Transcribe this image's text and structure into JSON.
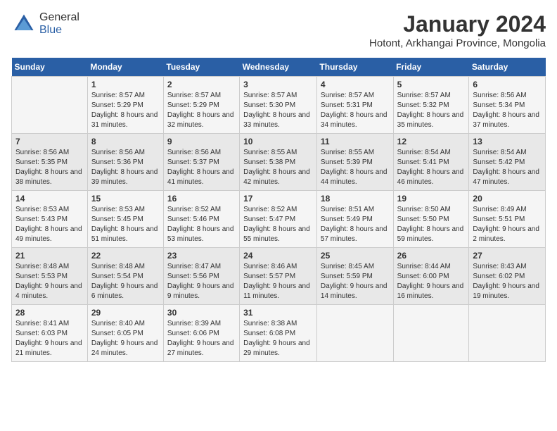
{
  "logo": {
    "general": "General",
    "blue": "Blue"
  },
  "header": {
    "title": "January 2024",
    "subtitle": "Hotont, Arkhangai Province, Mongolia"
  },
  "weekdays": [
    "Sunday",
    "Monday",
    "Tuesday",
    "Wednesday",
    "Thursday",
    "Friday",
    "Saturday"
  ],
  "weeks": [
    [
      {
        "day": "",
        "sunrise": "",
        "sunset": "",
        "daylight": ""
      },
      {
        "day": "1",
        "sunrise": "Sunrise: 8:57 AM",
        "sunset": "Sunset: 5:29 PM",
        "daylight": "Daylight: 8 hours and 31 minutes."
      },
      {
        "day": "2",
        "sunrise": "Sunrise: 8:57 AM",
        "sunset": "Sunset: 5:29 PM",
        "daylight": "Daylight: 8 hours and 32 minutes."
      },
      {
        "day": "3",
        "sunrise": "Sunrise: 8:57 AM",
        "sunset": "Sunset: 5:30 PM",
        "daylight": "Daylight: 8 hours and 33 minutes."
      },
      {
        "day": "4",
        "sunrise": "Sunrise: 8:57 AM",
        "sunset": "Sunset: 5:31 PM",
        "daylight": "Daylight: 8 hours and 34 minutes."
      },
      {
        "day": "5",
        "sunrise": "Sunrise: 8:57 AM",
        "sunset": "Sunset: 5:32 PM",
        "daylight": "Daylight: 8 hours and 35 minutes."
      },
      {
        "day": "6",
        "sunrise": "Sunrise: 8:56 AM",
        "sunset": "Sunset: 5:34 PM",
        "daylight": "Daylight: 8 hours and 37 minutes."
      }
    ],
    [
      {
        "day": "7",
        "sunrise": "Sunrise: 8:56 AM",
        "sunset": "Sunset: 5:35 PM",
        "daylight": "Daylight: 8 hours and 38 minutes."
      },
      {
        "day": "8",
        "sunrise": "Sunrise: 8:56 AM",
        "sunset": "Sunset: 5:36 PM",
        "daylight": "Daylight: 8 hours and 39 minutes."
      },
      {
        "day": "9",
        "sunrise": "Sunrise: 8:56 AM",
        "sunset": "Sunset: 5:37 PM",
        "daylight": "Daylight: 8 hours and 41 minutes."
      },
      {
        "day": "10",
        "sunrise": "Sunrise: 8:55 AM",
        "sunset": "Sunset: 5:38 PM",
        "daylight": "Daylight: 8 hours and 42 minutes."
      },
      {
        "day": "11",
        "sunrise": "Sunrise: 8:55 AM",
        "sunset": "Sunset: 5:39 PM",
        "daylight": "Daylight: 8 hours and 44 minutes."
      },
      {
        "day": "12",
        "sunrise": "Sunrise: 8:54 AM",
        "sunset": "Sunset: 5:41 PM",
        "daylight": "Daylight: 8 hours and 46 minutes."
      },
      {
        "day": "13",
        "sunrise": "Sunrise: 8:54 AM",
        "sunset": "Sunset: 5:42 PM",
        "daylight": "Daylight: 8 hours and 47 minutes."
      }
    ],
    [
      {
        "day": "14",
        "sunrise": "Sunrise: 8:53 AM",
        "sunset": "Sunset: 5:43 PM",
        "daylight": "Daylight: 8 hours and 49 minutes."
      },
      {
        "day": "15",
        "sunrise": "Sunrise: 8:53 AM",
        "sunset": "Sunset: 5:45 PM",
        "daylight": "Daylight: 8 hours and 51 minutes."
      },
      {
        "day": "16",
        "sunrise": "Sunrise: 8:52 AM",
        "sunset": "Sunset: 5:46 PM",
        "daylight": "Daylight: 8 hours and 53 minutes."
      },
      {
        "day": "17",
        "sunrise": "Sunrise: 8:52 AM",
        "sunset": "Sunset: 5:47 PM",
        "daylight": "Daylight: 8 hours and 55 minutes."
      },
      {
        "day": "18",
        "sunrise": "Sunrise: 8:51 AM",
        "sunset": "Sunset: 5:49 PM",
        "daylight": "Daylight: 8 hours and 57 minutes."
      },
      {
        "day": "19",
        "sunrise": "Sunrise: 8:50 AM",
        "sunset": "Sunset: 5:50 PM",
        "daylight": "Daylight: 8 hours and 59 minutes."
      },
      {
        "day": "20",
        "sunrise": "Sunrise: 8:49 AM",
        "sunset": "Sunset: 5:51 PM",
        "daylight": "Daylight: 9 hours and 2 minutes."
      }
    ],
    [
      {
        "day": "21",
        "sunrise": "Sunrise: 8:48 AM",
        "sunset": "Sunset: 5:53 PM",
        "daylight": "Daylight: 9 hours and 4 minutes."
      },
      {
        "day": "22",
        "sunrise": "Sunrise: 8:48 AM",
        "sunset": "Sunset: 5:54 PM",
        "daylight": "Daylight: 9 hours and 6 minutes."
      },
      {
        "day": "23",
        "sunrise": "Sunrise: 8:47 AM",
        "sunset": "Sunset: 5:56 PM",
        "daylight": "Daylight: 9 hours and 9 minutes."
      },
      {
        "day": "24",
        "sunrise": "Sunrise: 8:46 AM",
        "sunset": "Sunset: 5:57 PM",
        "daylight": "Daylight: 9 hours and 11 minutes."
      },
      {
        "day": "25",
        "sunrise": "Sunrise: 8:45 AM",
        "sunset": "Sunset: 5:59 PM",
        "daylight": "Daylight: 9 hours and 14 minutes."
      },
      {
        "day": "26",
        "sunrise": "Sunrise: 8:44 AM",
        "sunset": "Sunset: 6:00 PM",
        "daylight": "Daylight: 9 hours and 16 minutes."
      },
      {
        "day": "27",
        "sunrise": "Sunrise: 8:43 AM",
        "sunset": "Sunset: 6:02 PM",
        "daylight": "Daylight: 9 hours and 19 minutes."
      }
    ],
    [
      {
        "day": "28",
        "sunrise": "Sunrise: 8:41 AM",
        "sunset": "Sunset: 6:03 PM",
        "daylight": "Daylight: 9 hours and 21 minutes."
      },
      {
        "day": "29",
        "sunrise": "Sunrise: 8:40 AM",
        "sunset": "Sunset: 6:05 PM",
        "daylight": "Daylight: 9 hours and 24 minutes."
      },
      {
        "day": "30",
        "sunrise": "Sunrise: 8:39 AM",
        "sunset": "Sunset: 6:06 PM",
        "daylight": "Daylight: 9 hours and 27 minutes."
      },
      {
        "day": "31",
        "sunrise": "Sunrise: 8:38 AM",
        "sunset": "Sunset: 6:08 PM",
        "daylight": "Daylight: 9 hours and 29 minutes."
      },
      {
        "day": "",
        "sunrise": "",
        "sunset": "",
        "daylight": ""
      },
      {
        "day": "",
        "sunrise": "",
        "sunset": "",
        "daylight": ""
      },
      {
        "day": "",
        "sunrise": "",
        "sunset": "",
        "daylight": ""
      }
    ]
  ]
}
